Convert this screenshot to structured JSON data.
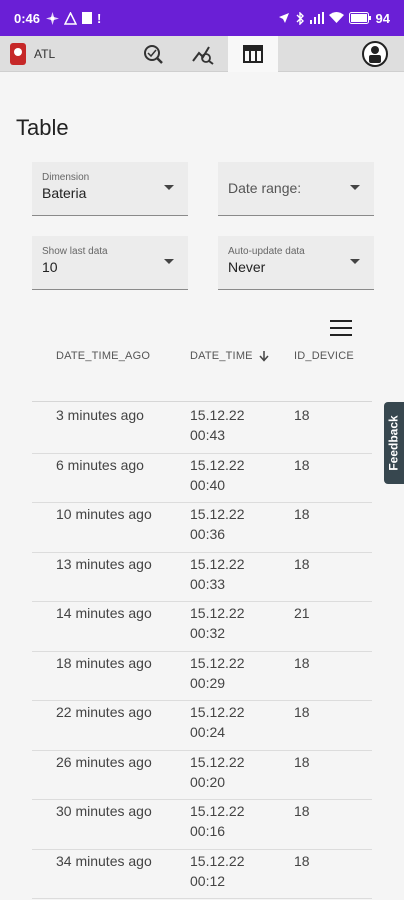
{
  "status": {
    "time": "0:46",
    "battery": "94"
  },
  "app": {
    "name": "ATL",
    "tabs": [
      {
        "id": "search",
        "icon": "search-map-icon"
      },
      {
        "id": "chart",
        "icon": "chart-icon"
      },
      {
        "id": "table",
        "icon": "table-icon",
        "active": true
      }
    ],
    "accent": "#6a1fd6"
  },
  "page": {
    "title": "Table"
  },
  "filters": {
    "dimension": {
      "label": "Dimension",
      "value": "Bateria"
    },
    "date_range": {
      "label": "Date range:"
    },
    "show_last": {
      "label": "Show last data",
      "value": "10"
    },
    "auto_update": {
      "label": "Auto-update data",
      "value": "Never"
    }
  },
  "table": {
    "columns": [
      "DATE_TIME_AGO",
      "DATE_TIME",
      "ID_DEVICE"
    ],
    "sort_icon": "arrow-down-icon",
    "rows": [
      {
        "ago": "3 minutes ago",
        "date": "15.12.22",
        "time": "00:43",
        "id": "18"
      },
      {
        "ago": "6 minutes ago",
        "date": "15.12.22",
        "time": "00:40",
        "id": "18"
      },
      {
        "ago": "10 minutes ago",
        "date": "15.12.22",
        "time": "00:36",
        "id": "18"
      },
      {
        "ago": "13 minutes ago",
        "date": "15.12.22",
        "time": "00:33",
        "id": "18"
      },
      {
        "ago": "14 minutes ago",
        "date": "15.12.22",
        "time": "00:32",
        "id": "21"
      },
      {
        "ago": "18 minutes ago",
        "date": "15.12.22",
        "time": "00:29",
        "id": "18"
      },
      {
        "ago": "22 minutes ago",
        "date": "15.12.22",
        "time": "00:24",
        "id": "18"
      },
      {
        "ago": "26 minutes ago",
        "date": "15.12.22",
        "time": "00:20",
        "id": "18"
      },
      {
        "ago": "30 minutes ago",
        "date": "15.12.22",
        "time": "00:16",
        "id": "18"
      },
      {
        "ago": "34 minutes ago",
        "date": "15.12.22",
        "time": "00:12",
        "id": "18"
      }
    ]
  },
  "feedback": {
    "label": "Feedback"
  }
}
